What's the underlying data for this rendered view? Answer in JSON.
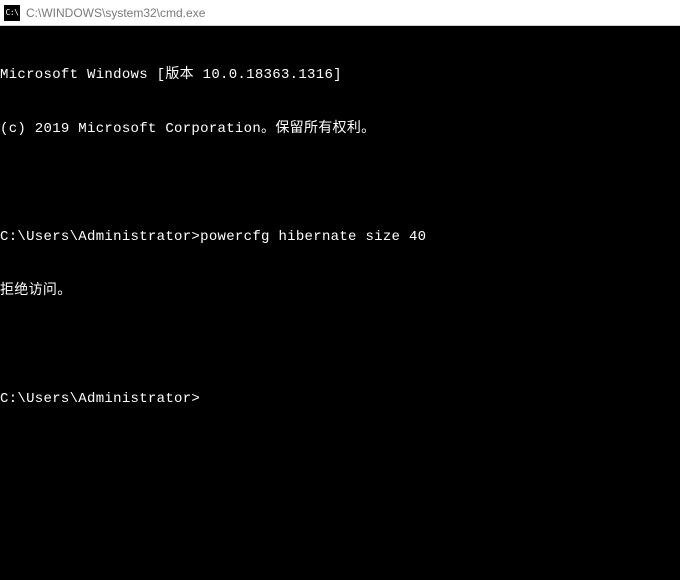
{
  "window": {
    "icon_label": "C:\\",
    "title": "C:\\WINDOWS\\system32\\cmd.exe"
  },
  "terminal": {
    "lines": [
      "Microsoft Windows [版本 10.0.18363.1316]",
      "(c) 2019 Microsoft Corporation。保留所有权利。",
      "",
      "C:\\Users\\Administrator>powercfg hibernate size 40",
      "拒绝访问。",
      "",
      "C:\\Users\\Administrator>"
    ]
  }
}
